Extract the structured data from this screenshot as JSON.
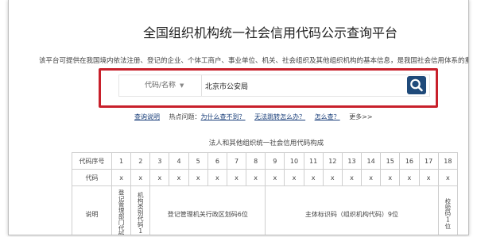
{
  "page": {
    "title": "全国组织机构统一社会信用代码公示查询平台",
    "intro": "该平台可提供在我国境内依法注册、登记的企业、个体工商户、事业单位、机关、社会组织及其他组织机构的基本信息，是我国社会信用体系的重"
  },
  "search": {
    "type_label": "代码/名称",
    "caret": "▼",
    "value": "北京市公安局"
  },
  "links": {
    "guide": "查询说明",
    "hot_prefix": "热点问题：",
    "q1": "为什么查不到？",
    "q2": "无法跳转怎么办？",
    "q3": "怎么查？",
    "more": "更多>>"
  },
  "code_table": {
    "title": "法人和其他组织统一社会信用代码构成",
    "row_headers": [
      "代码序号",
      "代码",
      "说明"
    ],
    "positions": [
      "1",
      "2",
      "3",
      "4",
      "5",
      "6",
      "7",
      "8",
      "9",
      "10",
      "11",
      "12",
      "13",
      "14",
      "15",
      "16",
      "17",
      "18"
    ],
    "codes": [
      "x",
      "x",
      "x",
      "x",
      "x",
      "x",
      "x",
      "x",
      "x",
      "x",
      "x",
      "x",
      "x",
      "x",
      "x",
      "x",
      "x",
      "x"
    ],
    "desc_1": "登记管理部门代码",
    "desc_2": "机构类别代码1",
    "desc_3_8": "登记管理机关行政区划码6位",
    "desc_9_17": "主体标识码（组织机构代码）9位",
    "desc_18": "校验码1位"
  }
}
